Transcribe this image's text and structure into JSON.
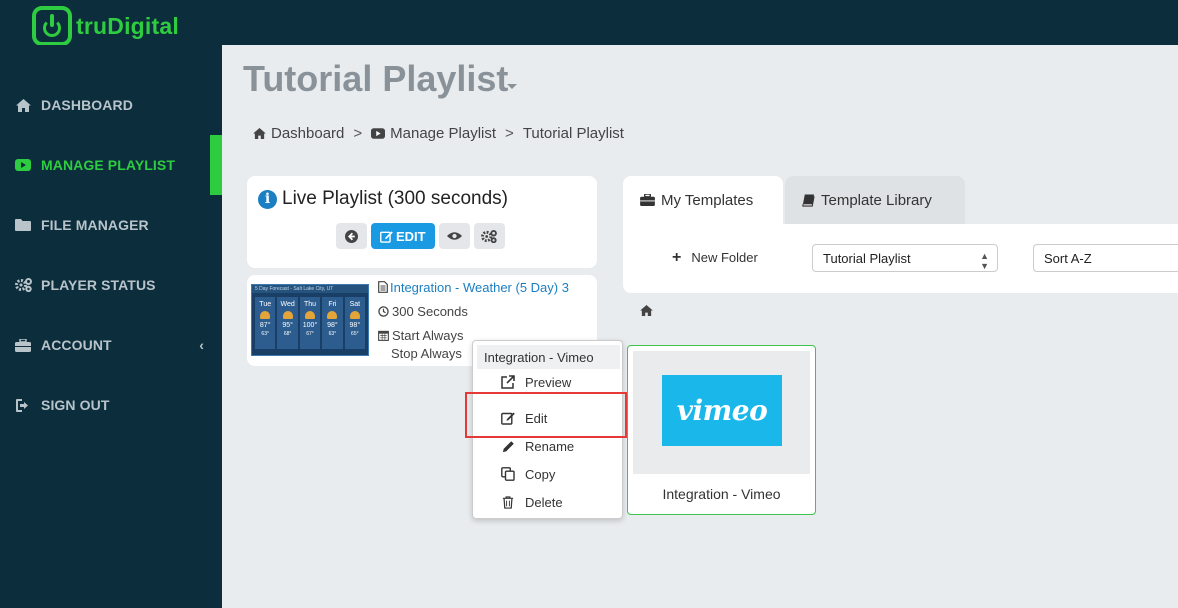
{
  "app": {
    "logo_text": "truDigital",
    "brand_color": "#2ecc40",
    "nav_bg": "#0c2d3c"
  },
  "sidebar": {
    "items": [
      {
        "label": "DASHBOARD",
        "icon": "home-icon"
      },
      {
        "label": "MANAGE PLAYLIST",
        "icon": "youtube-play-icon",
        "active": true
      },
      {
        "label": "FILE MANAGER",
        "icon": "folder-icon"
      },
      {
        "label": "PLAYER STATUS",
        "icon": "gears-icon"
      },
      {
        "label": "ACCOUNT",
        "icon": "briefcase-icon",
        "has_submenu": true,
        "chevron": "‹"
      },
      {
        "label": "SIGN OUT",
        "icon": "sign-out-icon"
      }
    ]
  },
  "header": {
    "title": "Tutorial Playlist",
    "breadcrumb": [
      "Dashboard",
      "Manage Playlist",
      "Tutorial Playlist"
    ],
    "breadcrumb_separator": ">"
  },
  "live_playlist": {
    "title": "Live Playlist (300 seconds)",
    "edit_label": "EDIT",
    "item": {
      "name": "Integration - Weather (5 Day) 3",
      "duration": "300 Seconds",
      "start": "Start Always",
      "stop": "Stop Always",
      "thumb_header": "5 Day Forecast - Salt Lake City, UT",
      "thumb_days": [
        {
          "day": "Tue",
          "hi": "87°",
          "lo": "63°"
        },
        {
          "day": "Wed",
          "hi": "95°",
          "lo": "68°"
        },
        {
          "day": "Thu",
          "hi": "100°",
          "lo": "67°"
        },
        {
          "day": "Fri",
          "hi": "98°",
          "lo": "63°"
        },
        {
          "day": "Sat",
          "hi": "98°",
          "lo": "65°"
        }
      ]
    }
  },
  "context_menu": {
    "header": "Integration - Vimeo",
    "items": [
      {
        "label": "Preview",
        "icon": "external-link-icon"
      },
      {
        "label": "Edit",
        "icon": "edit-icon",
        "highlighted": true
      },
      {
        "label": "Rename",
        "icon": "pencil-icon"
      },
      {
        "label": "Copy",
        "icon": "copy-icon"
      },
      {
        "label": "Delete",
        "icon": "trash-icon"
      }
    ],
    "highlight_color": "#e53935"
  },
  "templates": {
    "tabs": [
      {
        "label": "My Templates",
        "icon": "briefcase-icon",
        "active": true
      },
      {
        "label": "Template Library",
        "icon": "book-icon"
      }
    ],
    "new_folder_label": "New Folder",
    "folder_select": "Tutorial Playlist",
    "sort_select": "Sort A-Z",
    "tile": {
      "label": "Integration - Vimeo",
      "logo_text": "vimeo",
      "logo_color": "#1ab7ea"
    }
  }
}
